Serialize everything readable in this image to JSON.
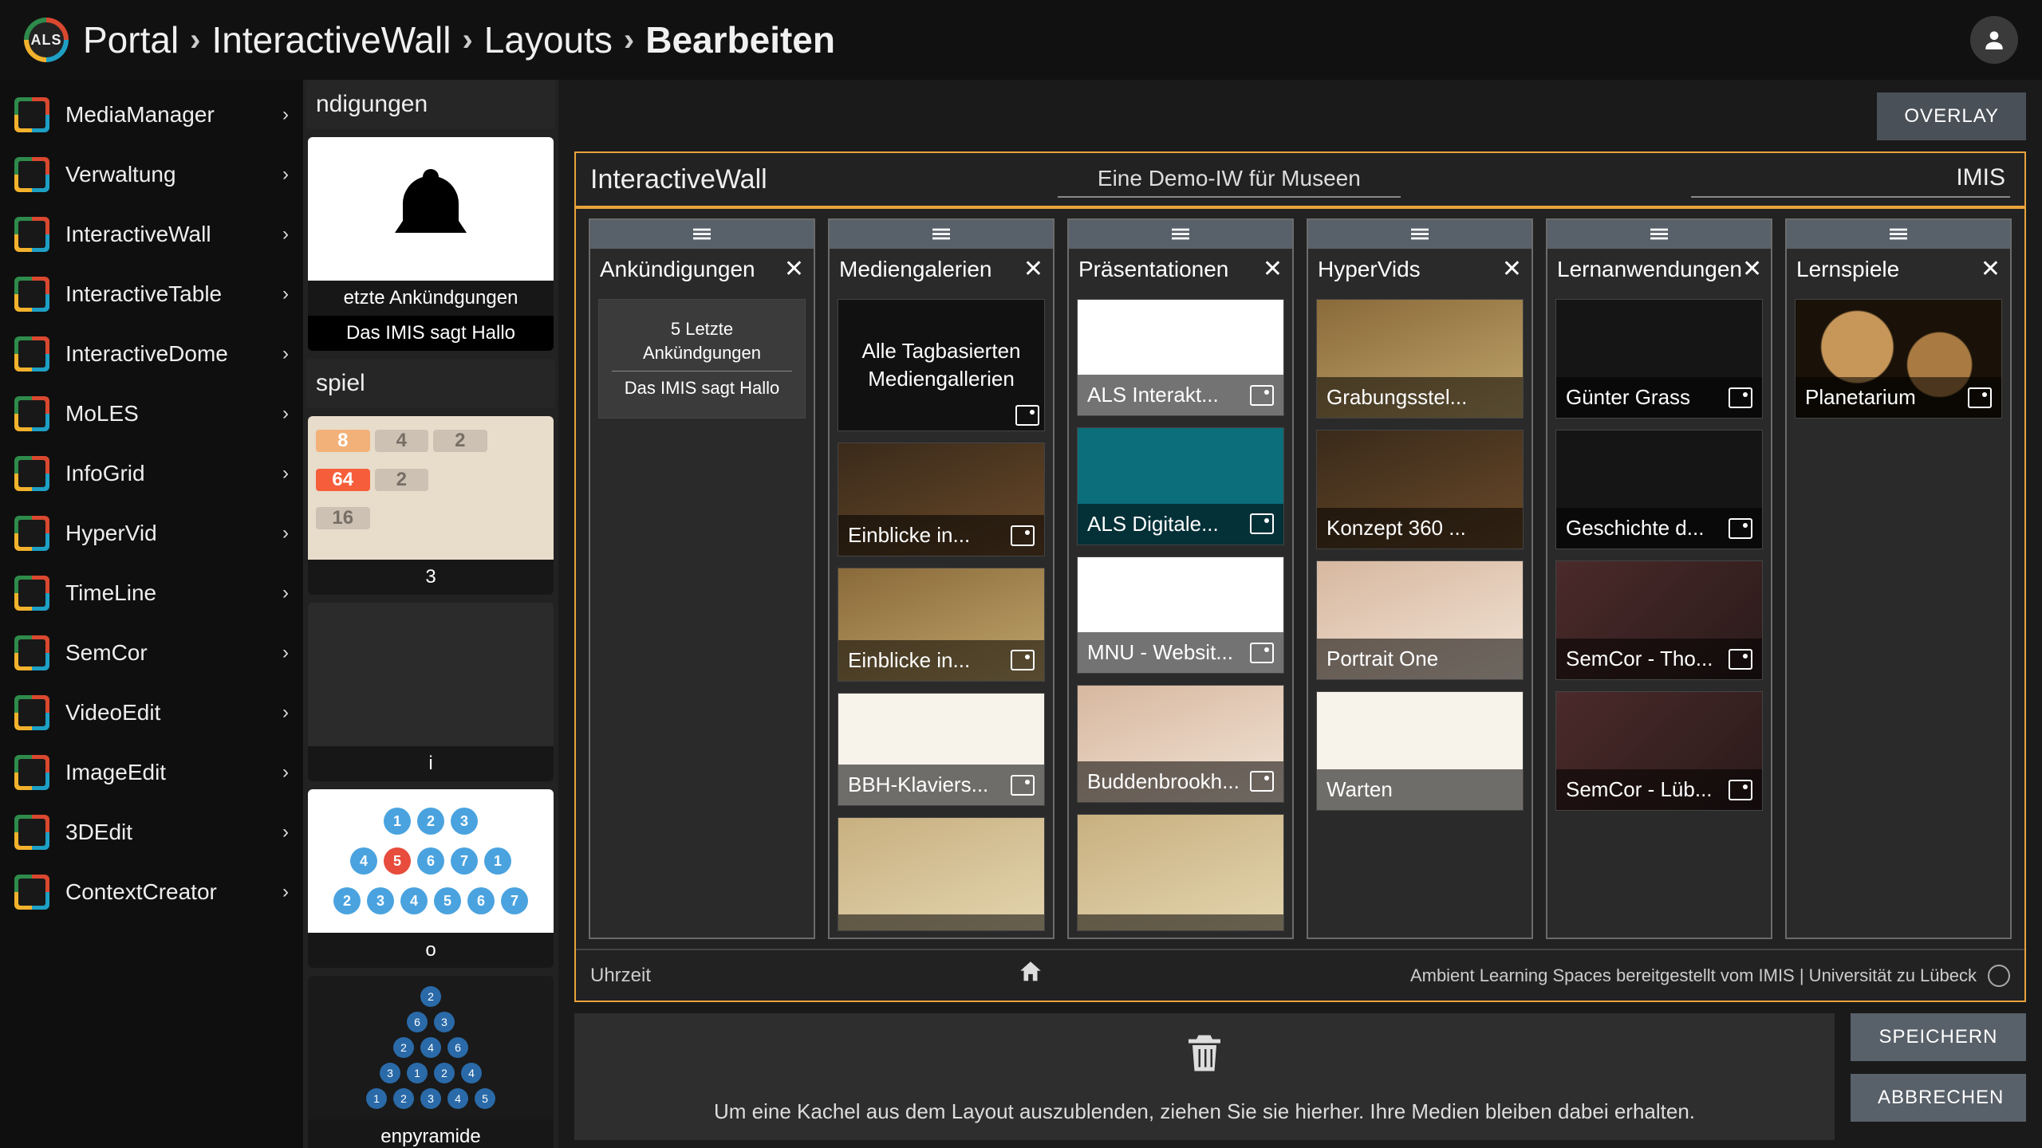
{
  "header": {
    "logo_text": "ALS",
    "breadcrumb": [
      "Portal",
      "InteractiveWall",
      "Layouts",
      "Bearbeiten"
    ]
  },
  "sidebar": {
    "items": [
      {
        "label": "MediaManager"
      },
      {
        "label": "Verwaltung"
      },
      {
        "label": "InteractiveWall"
      },
      {
        "label": "InteractiveTable"
      },
      {
        "label": "InteractiveDome"
      },
      {
        "label": "MoLES"
      },
      {
        "label": "InfoGrid"
      },
      {
        "label": "HyperVid"
      },
      {
        "label": "TimeLine"
      },
      {
        "label": "SemCor"
      },
      {
        "label": "VideoEdit"
      },
      {
        "label": "ImageEdit"
      },
      {
        "label": "3DEdit"
      },
      {
        "label": "ContextCreator"
      }
    ]
  },
  "palette": {
    "sections": [
      {
        "title": "ndigungen",
        "items": [
          {
            "caption": "etzte Ankündgungen",
            "sub": "Das IMIS sagt Hallo",
            "type": "bell"
          }
        ]
      },
      {
        "title": "spiel",
        "items": [
          {
            "caption": "3",
            "type": "g2048"
          },
          {
            "caption": "i",
            "type": "tetris"
          },
          {
            "caption": "o",
            "type": "solo"
          },
          {
            "caption": "enpyramide",
            "type": "pyr"
          }
        ]
      }
    ],
    "g2048_board": [
      [
        "8",
        "4",
        "2",
        ""
      ],
      [
        "64",
        "2",
        "",
        ""
      ],
      [
        "16",
        "",
        "",
        ""
      ]
    ]
  },
  "actions": {
    "overlay": "OVERLAY",
    "save": "SPEICHERN",
    "cancel": "ABBRECHEN"
  },
  "layout": {
    "title": "InteractiveWall",
    "subtitle": "Eine Demo-IW für Museen",
    "right_label": "IMIS",
    "status_left": "Uhrzeit",
    "status_right": "Ambient Learning Spaces bereitgestellt vom IMIS | Universität zu Lübeck",
    "trash_msg": "Um eine Kachel aus dem Layout auszublenden, ziehen Sie sie hierher. Ihre Medien bleiben dabei erhalten.",
    "columns": [
      {
        "name": "Ankündigungen",
        "closable": true,
        "tiles": [
          {
            "type": "announcement",
            "text_top": "5 Letzte Ankündgungen",
            "text_bottom": "Das IMIS sagt Hallo"
          }
        ]
      },
      {
        "name": "Mediengalerien",
        "closable": true,
        "tiles": [
          {
            "type": "text",
            "text": "Alle Tagbasierten Mediengallerien",
            "icon": true
          },
          {
            "type": "image",
            "thumb": "photo2",
            "text": "Einblicke in...",
            "icon": true
          },
          {
            "type": "image",
            "thumb": "photo1",
            "text": "Einblicke in...",
            "icon": true
          },
          {
            "type": "image",
            "thumb": "paper",
            "text": "BBH-Klaviers...",
            "icon": true
          },
          {
            "type": "image",
            "thumb": "photo3",
            "text": "",
            "icon": false
          }
        ]
      },
      {
        "name": "Präsentationen",
        "closable": true,
        "tiles": [
          {
            "type": "image",
            "thumb": "white",
            "text": "ALS Interakt...",
            "icon": true
          },
          {
            "type": "image",
            "thumb": "teal",
            "text": "ALS Digitale...",
            "icon": true
          },
          {
            "type": "image",
            "thumb": "white",
            "text": "MNU - Websit...",
            "icon": true
          },
          {
            "type": "image",
            "thumb": "face",
            "text": "Buddenbrookh...",
            "icon": true
          },
          {
            "type": "image",
            "thumb": "photo3",
            "text": "",
            "icon": false
          }
        ]
      },
      {
        "name": "HyperVids",
        "closable": true,
        "tiles": [
          {
            "type": "image",
            "thumb": "photo1",
            "text": "Grabungsstel..."
          },
          {
            "type": "image",
            "thumb": "photo2",
            "text": "Konzept 360 ..."
          },
          {
            "type": "image",
            "thumb": "face",
            "text": "Portrait One"
          },
          {
            "type": "image",
            "thumb": "paper",
            "text": "Warten"
          }
        ]
      },
      {
        "name": "Lernanwendungen",
        "closable": true,
        "tiles": [
          {
            "type": "image",
            "thumb": "dark",
            "text": "Günter Grass",
            "icon": true
          },
          {
            "type": "image",
            "thumb": "dark",
            "text": "Geschichte d...",
            "icon": true
          },
          {
            "type": "image",
            "thumb": "maps",
            "text": "SemCor - Tho...",
            "icon": true
          },
          {
            "type": "image",
            "thumb": "maps",
            "text": "SemCor - Lüb...",
            "icon": true
          }
        ]
      },
      {
        "name": "Lernspiele",
        "closable": true,
        "tiles": [
          {
            "type": "image",
            "thumb": "space",
            "text": "Planetarium",
            "icon": true
          }
        ]
      }
    ]
  }
}
